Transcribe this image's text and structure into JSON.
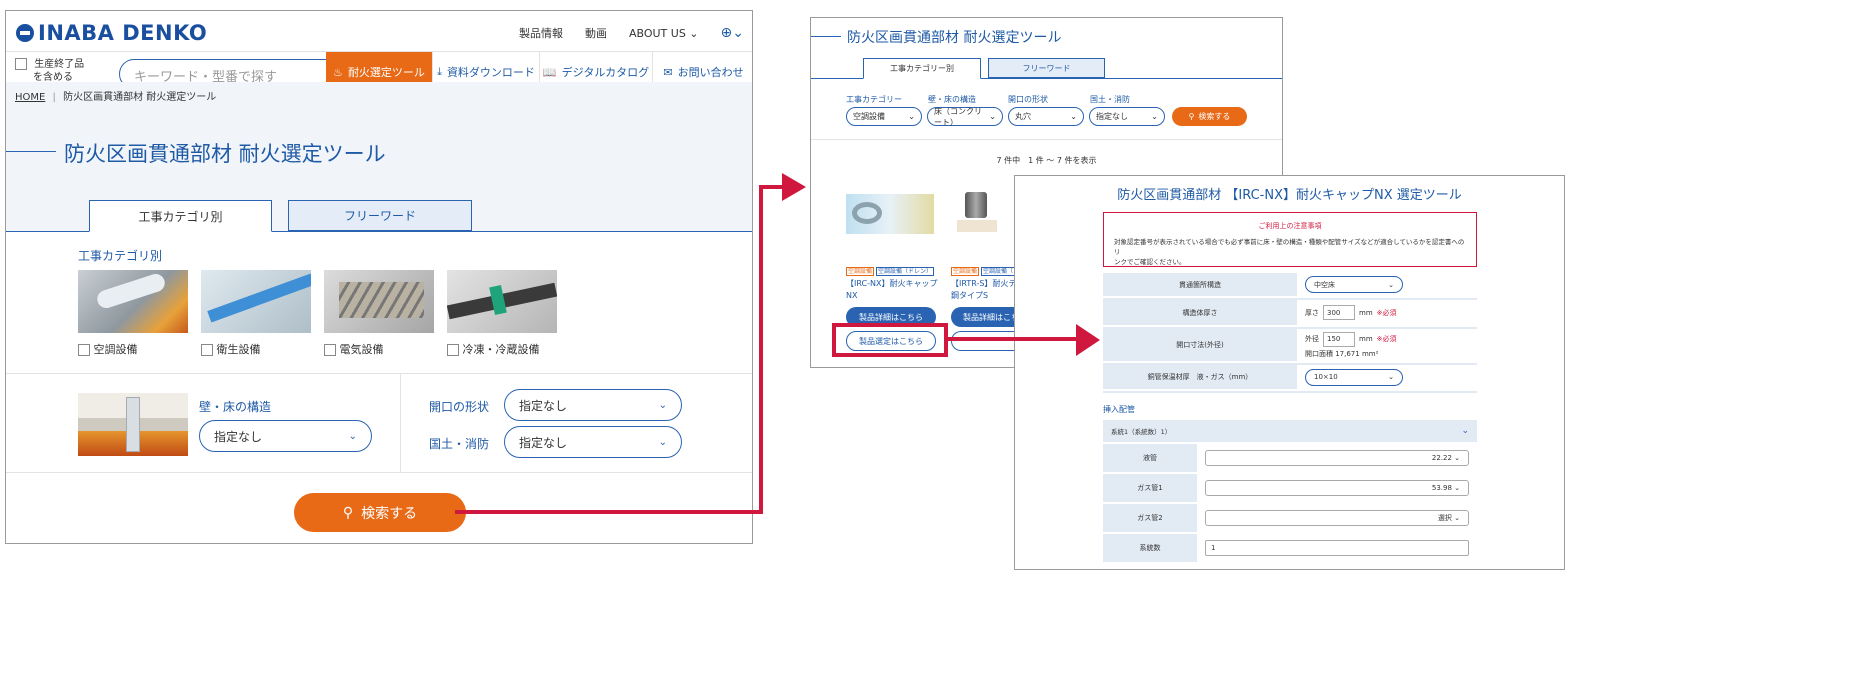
{
  "main": {
    "brand": "INABA DENKO",
    "topnav": [
      "製品情報",
      "動画",
      "ABOUT US"
    ],
    "discontinued_label_1": "生産終了品",
    "discontinued_label_2": "を含める",
    "search_placeholder": "キーワード・型番で探す",
    "nav_buttons": [
      "耐火選定ツール",
      "資料ダウンロード",
      "デジタルカタログ",
      "お問い合わせ"
    ],
    "breadcrumb_home": "HOME",
    "breadcrumb_current": "防火区画貫通部材 耐火選定ツール",
    "page_title": "防火区画貫通部材 耐火選定ツール",
    "tabs": [
      "工事カテゴリ別",
      "フリーワード"
    ],
    "category_heading": "工事カテゴリ別",
    "categories": [
      "空調設備",
      "衛生設備",
      "電気設備",
      "冷凍・冷蔵設備"
    ],
    "wall_label": "壁・床の構造",
    "wall_value": "指定なし",
    "opening_label": "開口の形状",
    "opening_value": "指定なし",
    "ministry_label": "国土・消防",
    "ministry_value": "指定なし",
    "search_button": "検索する"
  },
  "results": {
    "title": "防火区画貫通部材 耐火選定ツール",
    "tabs": [
      "工事カテゴリー別",
      "フリーワード"
    ],
    "filter_labels": [
      "工事カテゴリー",
      "壁・床の構造",
      "開口の形状",
      "国土・消防"
    ],
    "filter_values": [
      "空調設備",
      "床（コンクリート）",
      "丸穴",
      "指定なし"
    ],
    "search_button": "検索する",
    "count": "7 件中　1 件 〜 7 件を表示",
    "product1_tags": [
      "空調設備",
      "空調設備（ドレン）"
    ],
    "product1_name_1": "【IRC-NX】耐火キャップ",
    "product1_name_2": "NX",
    "product2_tags": [
      "空調設備",
      "空調設備（ドレ"
    ],
    "product2_name_1": "【IRTR-S】耐火テ",
    "product2_name_2": "鋼タイプS",
    "detail_button": "製品詳細はこちら",
    "detail_button_2": "製品詳細はこち",
    "select_button": "製品選定はこちら"
  },
  "selector": {
    "title": "防火区画貫通部材 【IRC-NX】耐火キャップNX 選定ツール",
    "notice_title": "ご利用上の注意事項",
    "notice_text_1": "対象認定番号が表示されている場合でも必ず事前に床・壁の構造・種類や配管サイズなどが適合しているかを認定書へのリ",
    "notice_text_2": "ンクでご確認ください。",
    "rows": [
      {
        "label": "貫通箇所構造",
        "value": "中空床"
      },
      {
        "label": "構造体厚さ",
        "prefix": "厚さ",
        "value": "300",
        "unit": "mm",
        "required": "※必須"
      },
      {
        "label": "開口寸法(外径)",
        "prefix": "外径",
        "value": "150",
        "unit": "mm",
        "required": "※必須",
        "extra": "開口面積 17,671 mm²"
      },
      {
        "label": "銅管保温材厚　液・ガス（mm）",
        "value": "10×10"
      }
    ],
    "insert_heading": "挿入配管",
    "system_header": "系統1（系統数）1）",
    "pipes": [
      {
        "label": "液管",
        "value": "22.22"
      },
      {
        "label": "ガス管1",
        "value": "53.98"
      },
      {
        "label": "ガス管2",
        "value": "選択"
      },
      {
        "label": "系統数",
        "value": "1"
      }
    ]
  }
}
